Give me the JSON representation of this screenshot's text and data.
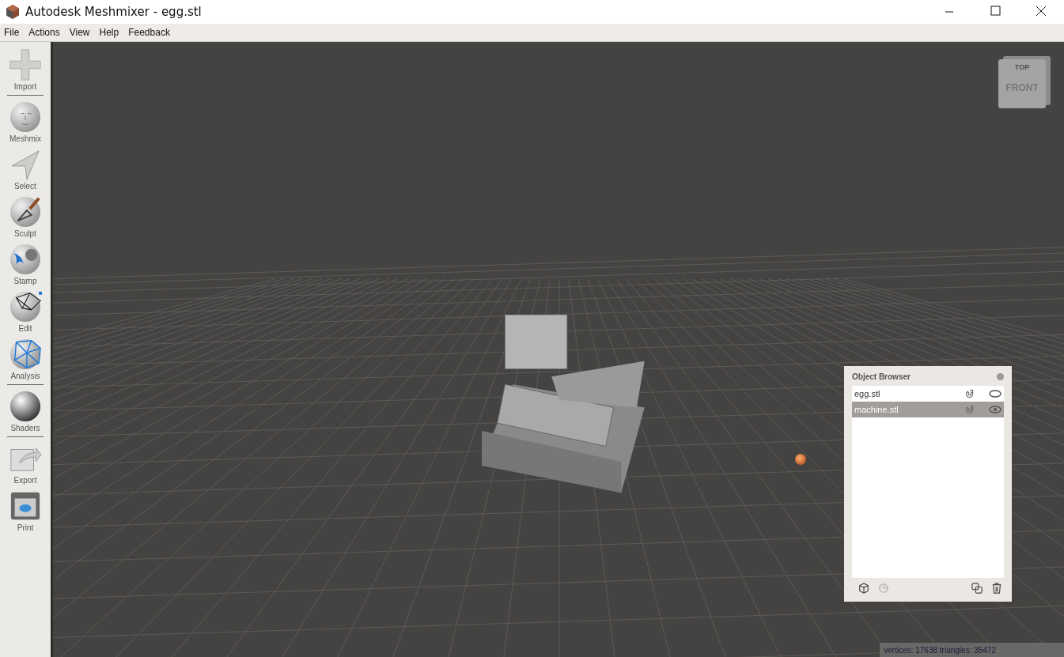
{
  "window": {
    "title": "Autodesk Meshmixer - egg.stl"
  },
  "menu": [
    "File",
    "Actions",
    "View",
    "Help",
    "Feedback"
  ],
  "tools": [
    {
      "label": "Import",
      "divider_after": true
    },
    {
      "label": "Meshmix",
      "divider_after": false
    },
    {
      "label": "Select",
      "divider_after": false
    },
    {
      "label": "Sculpt",
      "divider_after": false
    },
    {
      "label": "Stamp",
      "divider_after": false
    },
    {
      "label": "Edit",
      "divider_after": false
    },
    {
      "label": "Analysis",
      "divider_after": true
    },
    {
      "label": "Shaders",
      "divider_after": true
    },
    {
      "label": "Export",
      "divider_after": false
    },
    {
      "label": "Print",
      "divider_after": false
    }
  ],
  "view_cube": {
    "top": "TOP",
    "front": "FRONT"
  },
  "object_browser": {
    "title": "Object Browser",
    "objects": [
      {
        "name": "egg.stl",
        "selected": false,
        "visible": false
      },
      {
        "name": "machine.stl",
        "selected": true,
        "visible": true
      }
    ]
  },
  "status_bar": "vertices: 17638 triangles: 35472"
}
